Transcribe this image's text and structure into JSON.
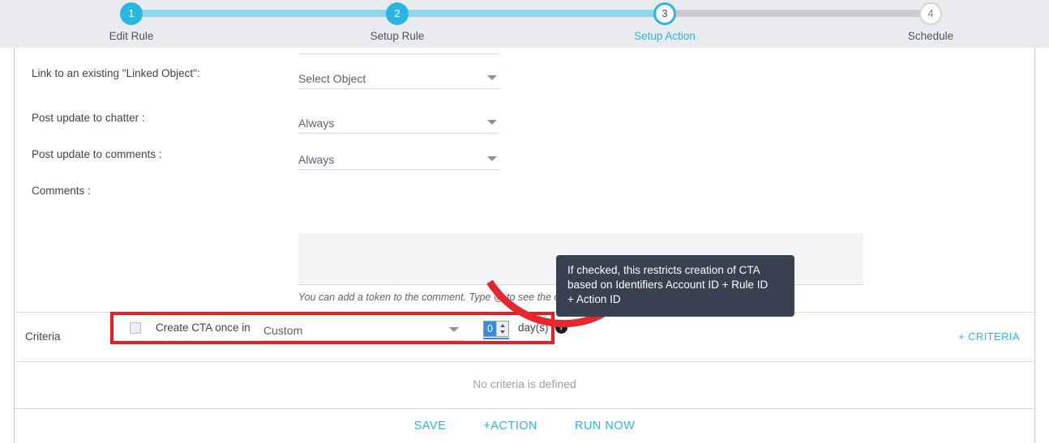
{
  "stepper": {
    "steps": [
      {
        "num": "1",
        "label": "Edit Rule",
        "state": "done"
      },
      {
        "num": "2",
        "label": "Setup Rule",
        "state": "done"
      },
      {
        "num": "3",
        "label": "Setup Action",
        "state": "active"
      },
      {
        "num": "4",
        "label": "Schedule",
        "state": "todo"
      }
    ],
    "accent_color": "#29b6e0",
    "track_done_color": "#8ed8ec",
    "track_todo_color": "#cbcccf"
  },
  "form": {
    "linked_object": {
      "label": "Link to an existing \"Linked Object\":",
      "value": "Select Object"
    },
    "chatter": {
      "label": "Post update to chatter :",
      "value": "Always"
    },
    "comments_update": {
      "label": "Post update to comments :",
      "value": "Always"
    },
    "comments": {
      "label": "Comments :",
      "value": "",
      "placeholder": "",
      "hint": "You can add a token to the comment. Type @ to see the options available."
    },
    "cta_once": {
      "checkbox_checked": false,
      "text": "Create CTA once in",
      "frequency_value": "Custom",
      "days_value": "0",
      "days_label": "day(s)",
      "help_icon": "question-mark-icon",
      "highlight_color": "#ed1c24"
    }
  },
  "tooltip": {
    "lines": [
      "If checked, this restricts creation of CTA",
      "based on Identifiers Account ID + Rule ID",
      "+ Action ID"
    ],
    "bg_color": "#37414f"
  },
  "annotation": {
    "arrow_color": "#e8262d",
    "shape": "curved-arrow"
  },
  "criteria": {
    "title": "Criteria",
    "add_link": "+ CRITERIA",
    "empty_message": "No criteria is defined"
  },
  "footer": {
    "actions": [
      {
        "label": "SAVE"
      },
      {
        "label": "+ACTION"
      },
      {
        "label": "RUN NOW"
      }
    ],
    "link_color": "#29b6e0"
  }
}
